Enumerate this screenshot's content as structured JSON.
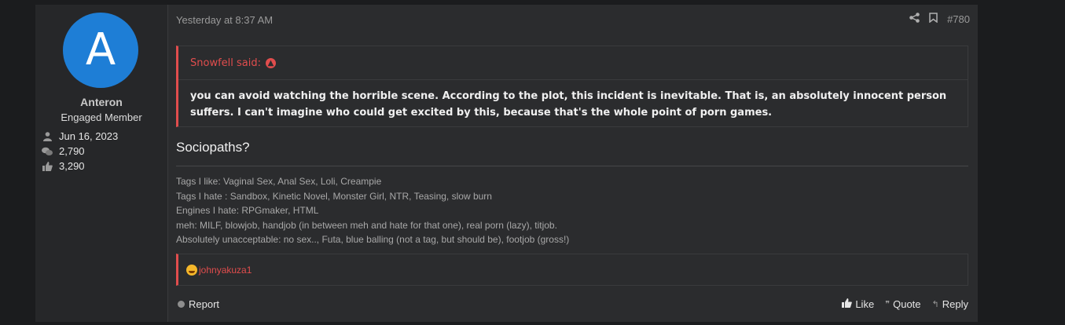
{
  "user": {
    "avatar_letter": "A",
    "avatar_color": "#1e7ed6",
    "name": "Anteron",
    "title": "Engaged Member",
    "joined": "Jun 16, 2023",
    "messages": "2,790",
    "reactions": "3,290"
  },
  "post": {
    "date": "Yesterday at 8:37 AM",
    "number": "#780",
    "quote": {
      "author_line": "Snowfell said:",
      "text": "you can avoid watching the horrible scene. According to the plot, this incident is inevitable. That is, an absolutely innocent person suffers. I can't imagine who could get excited by this, because that's the whole point of porn games."
    },
    "body": "Sociopaths?",
    "signature": [
      "Tags I like: Vaginal Sex, Anal Sex, Loli, Creampie",
      "Tags I hate : Sandbox, Kinetic Novel, Monster Girl, NTR, Teasing, slow burn",
      "Engines I hate: RPGmaker, HTML",
      "meh: MILF, blowjob, handjob (in between meh and hate for that one), real porn (lazy), titjob.",
      "Absolutely unacceptable: no sex.., Futa, blue balling (not a tag, but should be), footjob (gross!)"
    ],
    "reaction_user": "johnyakuza1"
  },
  "footer": {
    "report": "Report",
    "like": "Like",
    "quote": "Quote",
    "reply": "Reply"
  },
  "colors": {
    "accent": "#e14d4d",
    "background": "#1b1c1e",
    "panel": "#2b2c2e"
  },
  "icons": [
    "user-icon",
    "messages-icon",
    "thumbs-up-icon",
    "share-icon",
    "bookmark-icon",
    "arrow-up-circle-icon",
    "laughing-emoji-icon",
    "report-icon",
    "quote-icon",
    "reply-icon"
  ]
}
